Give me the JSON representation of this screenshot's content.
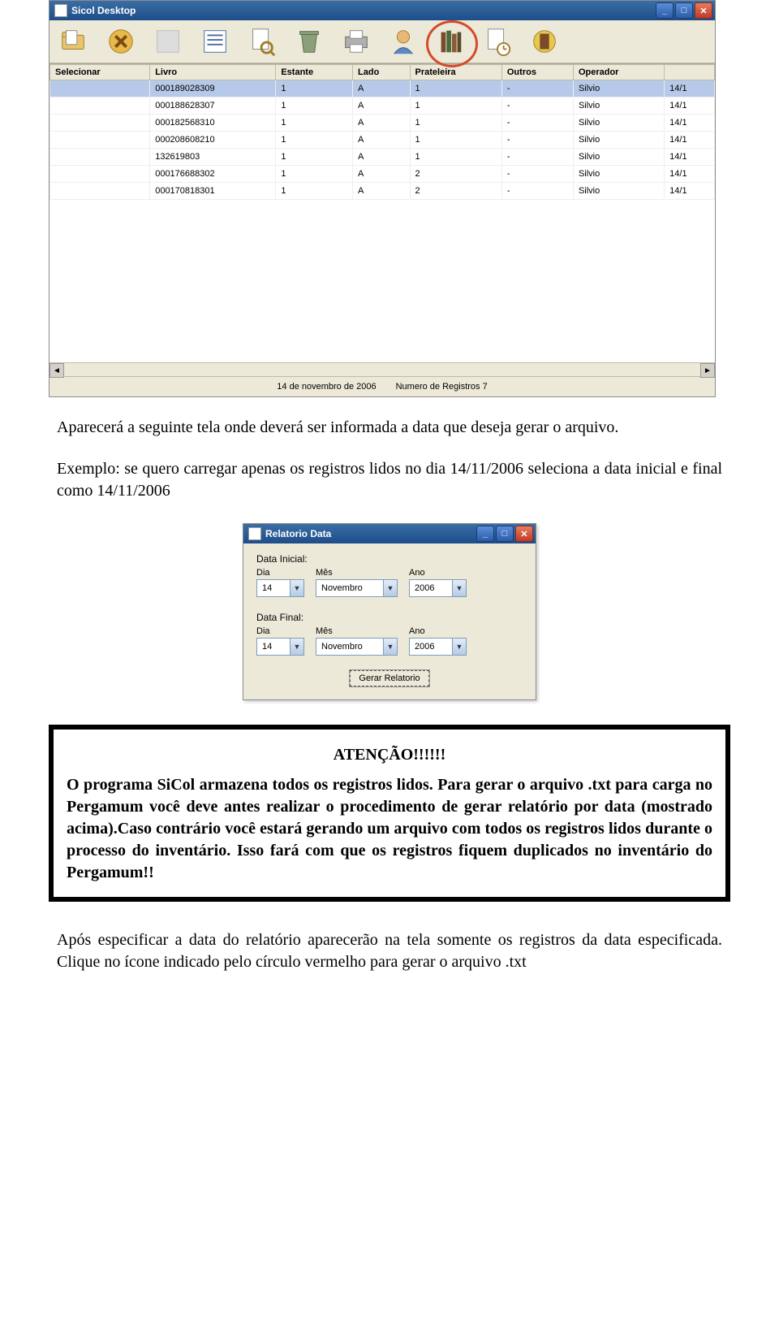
{
  "main_window": {
    "title": "Sicol Desktop",
    "columns": [
      "Selecionar",
      "Livro",
      "Estante",
      "Lado",
      "Prateleira",
      "Outros",
      "Operador",
      ""
    ],
    "rows": [
      {
        "livro": "000189028309",
        "estante": "1",
        "lado": "A",
        "prateleira": "1",
        "outros": "-",
        "operador": "Silvio",
        "extra": "14/1",
        "selected": true
      },
      {
        "livro": "000188628307",
        "estante": "1",
        "lado": "A",
        "prateleira": "1",
        "outros": "-",
        "operador": "Silvio",
        "extra": "14/1"
      },
      {
        "livro": "000182568310",
        "estante": "1",
        "lado": "A",
        "prateleira": "1",
        "outros": "-",
        "operador": "Silvio",
        "extra": "14/1"
      },
      {
        "livro": "000208608210",
        "estante": "1",
        "lado": "A",
        "prateleira": "1",
        "outros": "-",
        "operador": "Silvio",
        "extra": "14/1"
      },
      {
        "livro": "132619803",
        "estante": "1",
        "lado": "A",
        "prateleira": "1",
        "outros": "-",
        "operador": "Silvio",
        "extra": "14/1"
      },
      {
        "livro": "000176688302",
        "estante": "1",
        "lado": "A",
        "prateleira": "2",
        "outros": "-",
        "operador": "Silvio",
        "extra": "14/1"
      },
      {
        "livro": "000170818301",
        "estante": "1",
        "lado": "A",
        "prateleira": "2",
        "outros": "-",
        "operador": "Silvio",
        "extra": "14/1"
      }
    ],
    "status_date": "14 de novembro de 2006",
    "status_count": "Numero de Registros 7"
  },
  "doc": {
    "p1": "Aparecerá a seguinte tela onde deverá ser informada a data que deseja gerar o arquivo.",
    "p2": "Exemplo: se quero carregar apenas os registros lidos no dia 14/11/2006 seleciona a data inicial e final como 14/11/2006"
  },
  "dialog": {
    "title": "Relatorio Data",
    "group1": "Data Inicial:",
    "group2": "Data Final:",
    "lbl_dia": "Dia",
    "lbl_mes": "Mês",
    "lbl_ano": "Ano",
    "val_dia": "14",
    "val_mes": "Novembro",
    "val_ano": "2006",
    "button": "Gerar Relatorio"
  },
  "warning": {
    "title": "ATENÇÃO!!!!!!",
    "line1a": "O programa SiCol armazena todos os registros lidos. Para gerar o arquivo .txt para carga no Pergamum você deve antes realizar o procedimento de gerar relatório por data (mostrado acima).",
    "line1b": "Caso contrário você estará gerando um arquivo com todos os registros lidos durante o processo do inventário. Isso fará com que os registros fiquem duplicados no inventário do Pergamum!!"
  },
  "doc2": {
    "p": "Após especificar a data do relatório aparecerão na tela somente os registros da data especificada. Clique no ícone indicado pelo círculo vermelho para gerar o arquivo .txt"
  }
}
